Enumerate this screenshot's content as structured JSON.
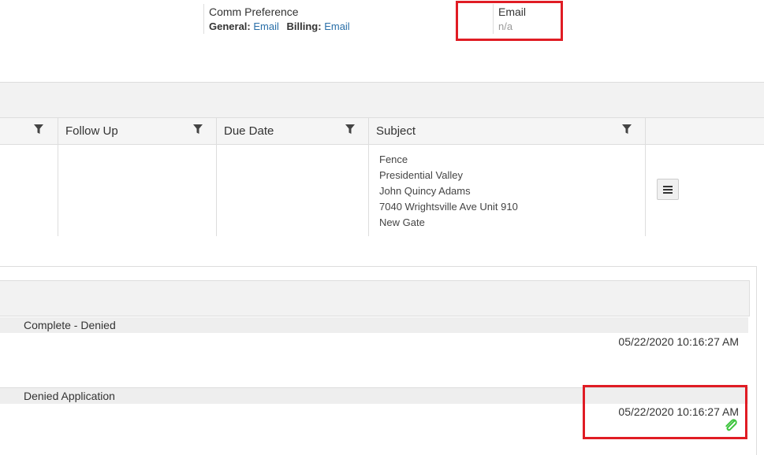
{
  "contact": {
    "comm_pref_label": "Comm Preference",
    "general_label": "General:",
    "general_value": "Email",
    "billing_label": "Billing:",
    "billing_value": "Email",
    "email_label": "Email",
    "email_value": "n/a"
  },
  "grid": {
    "columns": [
      "Follow Up",
      "Due Date",
      "Subject"
    ],
    "subject_lines": [
      "Fence",
      "Presidential Valley",
      "John Quincy Adams",
      "7040 Wrightsville Ave Unit 910",
      "New Gate"
    ]
  },
  "events": [
    {
      "title": "Complete - Denied",
      "timestamp": "05/22/2020 10:16:27 AM"
    },
    {
      "title": "Denied Application",
      "timestamp": "05/22/2020 10:16:27 AM"
    }
  ],
  "colors": {
    "highlight": "#e01c24",
    "link": "#2a6fa8",
    "attachment": "#3cc43c"
  }
}
